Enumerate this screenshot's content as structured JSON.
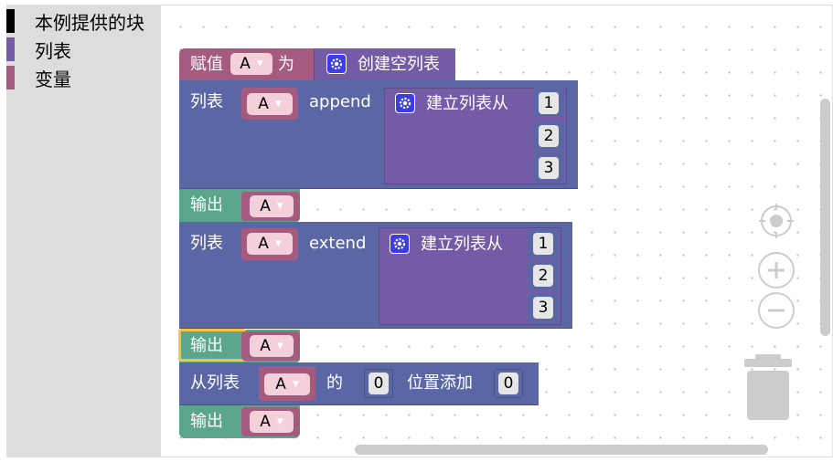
{
  "toolbox": {
    "categories": [
      {
        "label": "本例提供的块",
        "color": "#000000"
      },
      {
        "label": "列表",
        "color": "#745ba5"
      },
      {
        "label": "变量",
        "color": "#a55b80"
      }
    ]
  },
  "colors": {
    "list": "#745ba5",
    "variable": "#a55b80",
    "text": "#5ba58c",
    "op": "#5b67a5",
    "selected": "#f6c343"
  },
  "blocks": {
    "set": {
      "label": "赋值",
      "var": "A",
      "to": "为",
      "create_empty": "创建空列表"
    },
    "append": {
      "label": "列表",
      "var": "A",
      "method": "append",
      "create_with": "建立列表从",
      "items": [
        "1",
        "2",
        "3"
      ]
    },
    "print1": {
      "label": "输出",
      "var": "A"
    },
    "extend": {
      "label": "列表",
      "var": "A",
      "method": "extend",
      "create_with": "建立列表从",
      "items": [
        "1",
        "2",
        "3"
      ]
    },
    "print2": {
      "label": "输出",
      "var": "A"
    },
    "insert": {
      "label": "从列表",
      "var": "A",
      "of": "的",
      "index": "0",
      "insert_at": "位置添加",
      "value": "0"
    },
    "print3": {
      "label": "输出",
      "var": "A"
    }
  }
}
